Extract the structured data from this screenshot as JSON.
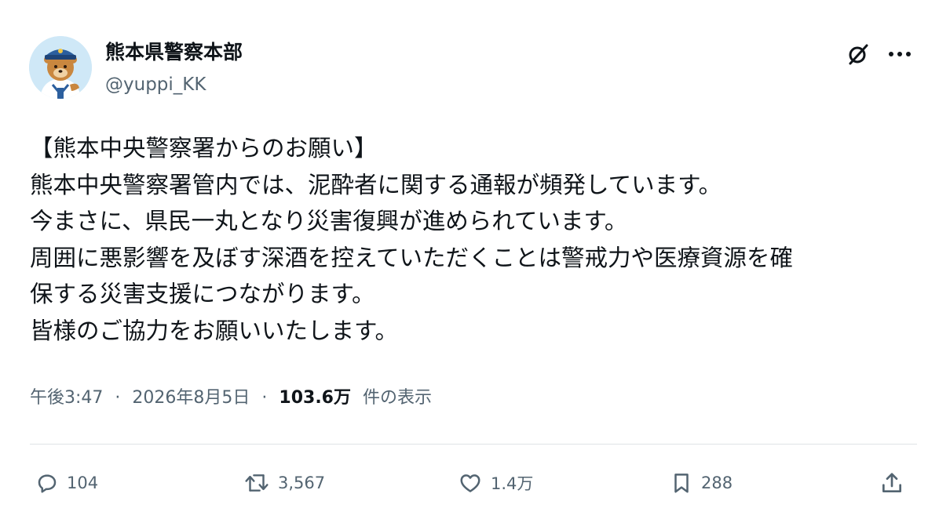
{
  "author": {
    "display_name": "熊本県警察本部",
    "handle": "@yuppi_KK",
    "avatar_icon": "police-mascot-avatar"
  },
  "header_actions": {
    "grok_icon": "grok-icon",
    "more_icon": "more-icon"
  },
  "post": {
    "lines": [
      "【熊本中央警察署からのお願い】",
      "熊本中央警察署管内では、泥酔者に関する通報が頻発しています。",
      "今まさに、県民一丸となり災害復興が進められています。",
      "周囲に悪影響を及ぼす深酒を控えていただくことは警戒力や医療資源を確",
      "保する災害支援につながります。",
      "皆様のご協力をお願いいたします。"
    ]
  },
  "meta": {
    "time": "午後3:47",
    "separator": "·",
    "date": "2026年8月5日",
    "views_count": "103.6万",
    "views_label": "件の表示"
  },
  "actions": {
    "replies": "104",
    "reposts": "3,567",
    "likes": "1.4万",
    "bookmarks": "288"
  },
  "colors": {
    "text_primary": "#0f1419",
    "text_secondary": "#536471",
    "divider": "#dfe3e6",
    "avatar_bg": "#cfe8f7"
  }
}
